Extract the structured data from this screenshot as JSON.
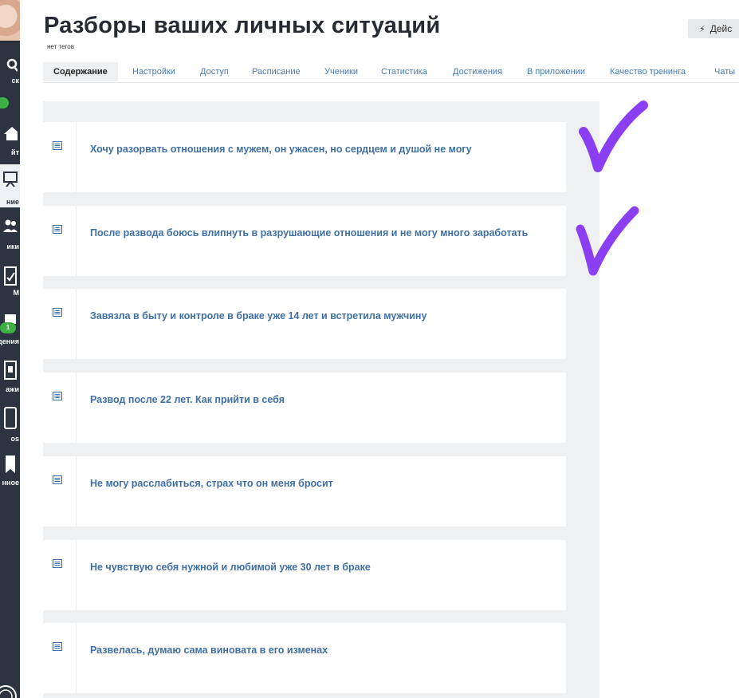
{
  "sidebar": {
    "items": [
      {
        "label": "ск",
        "icon": "search-icon"
      },
      {
        "label": "",
        "icon": "green-status"
      },
      {
        "label": "йт",
        "icon": "home-icon"
      },
      {
        "label": "ние",
        "icon": "presentation-icon"
      },
      {
        "label": "ики",
        "icon": "users-icon"
      },
      {
        "label": "M",
        "icon": "check-square-icon"
      },
      {
        "label": "дения",
        "icon": "messages-icon",
        "badge": "1"
      },
      {
        "label": "ажи",
        "icon": "shop-icon"
      },
      {
        "label": "os",
        "icon": "tablet-icon"
      },
      {
        "label": "нное",
        "icon": "bookmark-icon"
      }
    ]
  },
  "page": {
    "title": "Разборы ваших личных ситуаций",
    "tags": "нет тегов",
    "action_label": "Дейс"
  },
  "tabs": [
    {
      "label": "Содержание",
      "active": true
    },
    {
      "label": "Настройки"
    },
    {
      "label": "Доступ"
    },
    {
      "label": "Расписание"
    },
    {
      "label": "Ученики"
    },
    {
      "label": "Статистика"
    },
    {
      "label": "Достижения"
    },
    {
      "label": "В приложении"
    },
    {
      "label": "Качество тренинга"
    },
    {
      "label": "Чаты"
    }
  ],
  "lessons": [
    {
      "title": "Хочу разорвать отношения с мужем, он ужасен, но сердцем и душой не могу"
    },
    {
      "title": "После развода боюсь влипнуть в разрушающие отношения и не могу много заработать"
    },
    {
      "title": "Завязла в быту и контроле в браке уже 14 лет и встретила мужчину"
    },
    {
      "title": "Развод после 22 лет. Как прийти в себя"
    },
    {
      "title": "Не могу расслабиться, страх что он меня бросит"
    },
    {
      "title": "Не чувствую себя нужной и любимой уже 30 лет в браке"
    },
    {
      "title": "Развелась, думаю сама виновата в его изменах"
    }
  ],
  "colors": {
    "link": "#3f6fa5",
    "sidebar": "#2b3440",
    "checkmark": "#8a3ff2",
    "badge": "#3cb043"
  }
}
